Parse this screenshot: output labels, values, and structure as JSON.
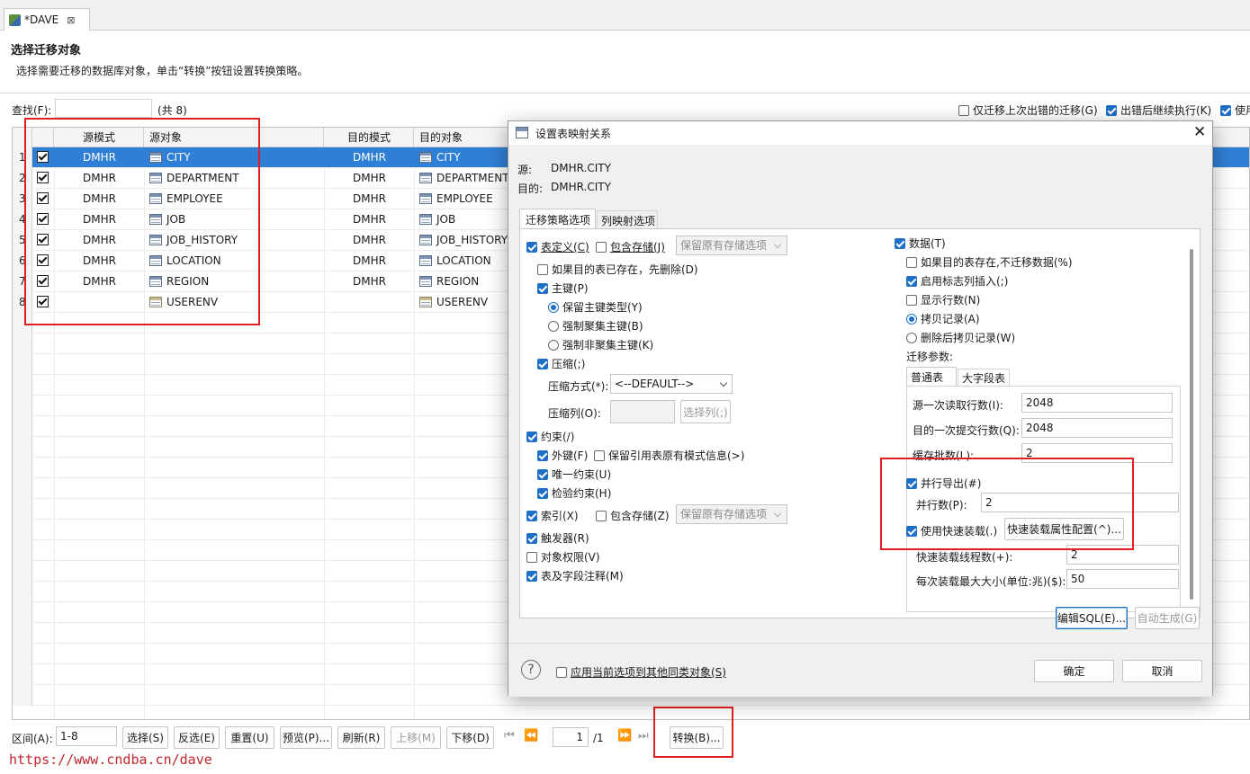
{
  "editor": {
    "tab_title": "*DAVE"
  },
  "header": {
    "title": "选择迁移对象",
    "description": "选择需要迁移的数据库对象，单击“转换”按钮设置转换策略。"
  },
  "search": {
    "label": "查找(F):",
    "value": "",
    "count": "(共 8)"
  },
  "top_options": {
    "only_failed": "仅迁移上次出错的迁移(G)",
    "continue_on_error": "出错后继续执行(K)",
    "use_truncated": "使用"
  },
  "table": {
    "columns": [
      "源模式",
      "源对象",
      "目的模式",
      "目的对象"
    ],
    "rows": [
      {
        "num": "1",
        "src_schema": "DMHR",
        "src_obj": "CITY",
        "dst_schema": "DMHR",
        "dst_obj": "CITY",
        "type": "table",
        "checked": true
      },
      {
        "num": "2",
        "src_schema": "DMHR",
        "src_obj": "DEPARTMENT",
        "dst_schema": "DMHR",
        "dst_obj": "DEPARTMENT",
        "type": "table",
        "checked": true
      },
      {
        "num": "3",
        "src_schema": "DMHR",
        "src_obj": "EMPLOYEE",
        "dst_schema": "DMHR",
        "dst_obj": "EMPLOYEE",
        "type": "table",
        "checked": true
      },
      {
        "num": "4",
        "src_schema": "DMHR",
        "src_obj": "JOB",
        "dst_schema": "DMHR",
        "dst_obj": "JOB",
        "type": "table",
        "checked": true
      },
      {
        "num": "5",
        "src_schema": "DMHR",
        "src_obj": "JOB_HISTORY",
        "dst_schema": "DMHR",
        "dst_obj": "JOB_HISTORY",
        "type": "table",
        "checked": true
      },
      {
        "num": "6",
        "src_schema": "DMHR",
        "src_obj": "LOCATION",
        "dst_schema": "DMHR",
        "dst_obj": "LOCATION",
        "type": "table",
        "checked": true
      },
      {
        "num": "7",
        "src_schema": "DMHR",
        "src_obj": "REGION",
        "dst_schema": "DMHR",
        "dst_obj": "REGION",
        "type": "table",
        "checked": true
      },
      {
        "num": "8",
        "src_schema": "",
        "src_obj": "USERENV",
        "dst_schema": "",
        "dst_obj": "USERENV",
        "type": "view",
        "checked": true
      }
    ]
  },
  "bottom": {
    "range_label": "区间(A):",
    "range_value": "1-8",
    "select": "选择(S)",
    "invert": "反选(E)",
    "reset": "重置(U)",
    "preview": "预览(P)...",
    "refresh": "刷新(R)",
    "move_up": "上移(M)",
    "move_down": "下移(D)",
    "page_value": "1",
    "page_total": "/1",
    "convert": "转换(B)..."
  },
  "watermark": "https://www.cndba.cn/dave",
  "dialog": {
    "title": "设置表映射关系",
    "source_label": "源:",
    "source_value": "DMHR.CITY",
    "dest_label": "目的:",
    "dest_value": "DMHR.CITY",
    "tabs": [
      "迁移策略选项",
      "列映射选项"
    ],
    "left": {
      "table_def": "表定义(C)",
      "include_storage": "包含存储(J)",
      "keep_storage": "保留原有存储选项",
      "drop_if_exists": "如果目的表已存在，先删除(D)",
      "primary_key": "主键(P)",
      "keep_pk_type": "保留主键类型(Y)",
      "force_cluster_pk": "强制聚集主键(B)",
      "force_noncluster_pk": "强制非聚集主键(K)",
      "compress": "压缩(;)",
      "compress_mode_label": "压缩方式(*):",
      "compress_mode_value": "<--DEFAULT-->",
      "compress_cols_label": "压缩列(O):",
      "select_cols": "选择列(;)",
      "constraints": "约束(/)",
      "foreign_key": "外键(F)",
      "keep_ref_schema": "保留引用表原有模式信息(>)",
      "unique": "唯一约束(U)",
      "check": "检验约束(H)",
      "index": "索引(X)",
      "index_storage": "包含存储(Z)",
      "index_keep_storage": "保留原有存储选项",
      "trigger": "触发器(R)",
      "privileges": "对象权限(V)",
      "comments": "表及字段注释(M)"
    },
    "right": {
      "data": "数据(T)",
      "skip_if_exists": "如果目的表存在,不迁移数据(%)",
      "identity_insert": "启用标志列插入(;)",
      "show_rows": "显示行数(N)",
      "copy_records": "拷贝记录(A)",
      "delete_then_copy": "删除后拷贝记录(W)",
      "params_label": "迁移参数:",
      "param_tabs": [
        "普通表",
        "大字段表"
      ],
      "read_rows_label": "源一次读取行数(I):",
      "read_rows": "2048",
      "commit_rows_label": "目的一次提交行数(Q):",
      "commit_rows": "2048",
      "batch_label": "缓存批数(L):",
      "batch": "2",
      "parallel_export": "并行导出(#)",
      "parallel_count_label": "并行数(P):",
      "parallel_count": "2",
      "fast_load": "使用快速装载(.)",
      "fast_load_config": "快速装载属性配置(^)...",
      "fast_load_threads_label": "快速装载线程数(+):",
      "fast_load_threads": "2",
      "max_load_label": "每次装载最大大小(单位:兆)($):",
      "max_load": "50"
    },
    "edit_sql": "编辑SQL(E)...",
    "auto_gen": "自动生成(G)",
    "apply_all": "应用当前选项到其他同类对象(S)",
    "ok": "确定",
    "cancel": "取消"
  },
  "colors": {
    "selection": "#2f7fd6",
    "checkbox": "#1f6fc6",
    "highlight": "#e02020",
    "watermark": "#c0262d"
  }
}
